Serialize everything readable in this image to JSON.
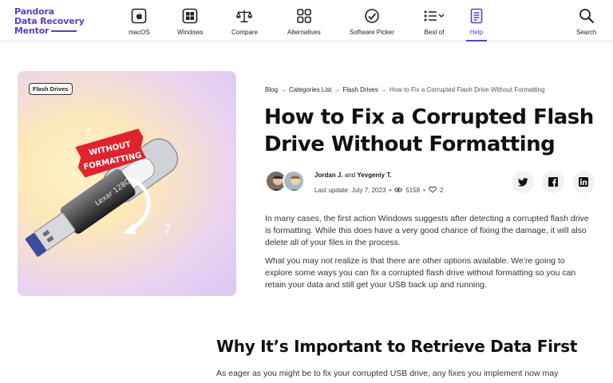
{
  "header": {
    "logo": {
      "line1": "Pandora",
      "line2": "Data Recovery",
      "line3": "Mentor"
    },
    "nav": [
      {
        "label": "macOS",
        "icon": "apple-icon"
      },
      {
        "label": "Windows",
        "icon": "windows-icon"
      },
      {
        "label": "Compare",
        "icon": "scale-icon"
      },
      {
        "label": "Alternatives",
        "icon": "grid-icon"
      },
      {
        "label": "Software Picker",
        "icon": "check-circle-icon"
      },
      {
        "label": "Best of",
        "icon": "list-icon"
      },
      {
        "label": "Help",
        "icon": "document-icon",
        "active": true
      },
      {
        "label": "Search",
        "icon": "search-icon"
      }
    ],
    "accent_color": "#5b3fc9"
  },
  "hero": {
    "badge": "Flash Drives",
    "sticker_text": "WITHOUT FORMATTING",
    "drive_brand": "Lexar",
    "drive_capacity": "128G"
  },
  "breadcrumb": {
    "items": [
      "Blog",
      "Categories List",
      "Flash Drives"
    ],
    "current": "How to Fix a Corrupted Flash Drive Without Formatting"
  },
  "article": {
    "title": "How to Fix a Corrupted Flash Drive Without Formatting",
    "author1": "Jordan J.",
    "and": "and",
    "author2": "Yevgeniy T.",
    "last_update": "Last update: July 7, 2023",
    "views": "5158",
    "likes": "2",
    "share": [
      "twitter-icon",
      "facebook-icon",
      "linkedin-icon"
    ],
    "paragraph1": "In many cases, the first action Windows suggests after detecting a corrupted flash drive is formatting. While this does have a very good chance of fixing the damage, it will also delete all of your files in the process.",
    "paragraph2": "What you may not realize is that there are other options available. We’re going to explore some ways you can fix a corrupted flash drive without formatting so you can retain your data and still get your USB back up and running.",
    "section_heading": "Why It’s Important to Retrieve Data First",
    "section_paragraph": "As eager as you might be to fix your corrupted USB drive, any fixes you implement now may"
  }
}
